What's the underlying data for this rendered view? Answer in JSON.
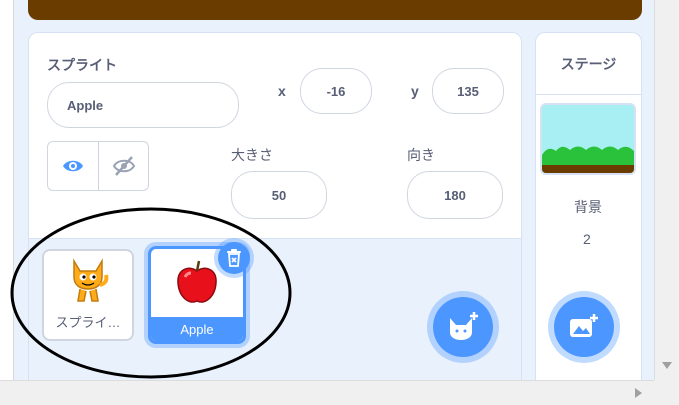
{
  "sprite_panel": {
    "title": "スプライト",
    "name_value": "Apple",
    "x_label": "x",
    "x_value": "-16",
    "y_label": "y",
    "y_value": "135",
    "size_label": "大きさ",
    "size_value": "50",
    "direction_label": "向き",
    "direction_value": "180",
    "show_icon": "eye-icon",
    "hide_icon": "eye-slash-icon"
  },
  "sprites": [
    {
      "name": "スプライ…",
      "icon": "cat-icon",
      "selected": false
    },
    {
      "name": "Apple",
      "icon": "apple-icon",
      "selected": true
    }
  ],
  "stage_panel": {
    "title": "ステージ",
    "backdrops_label": "背景",
    "backdrops_count": "2"
  },
  "colors": {
    "accent": "#4c97ff",
    "panel_bg": "#e9f1fc",
    "text": "#575e75",
    "stage_brown": "#6b3c00"
  }
}
